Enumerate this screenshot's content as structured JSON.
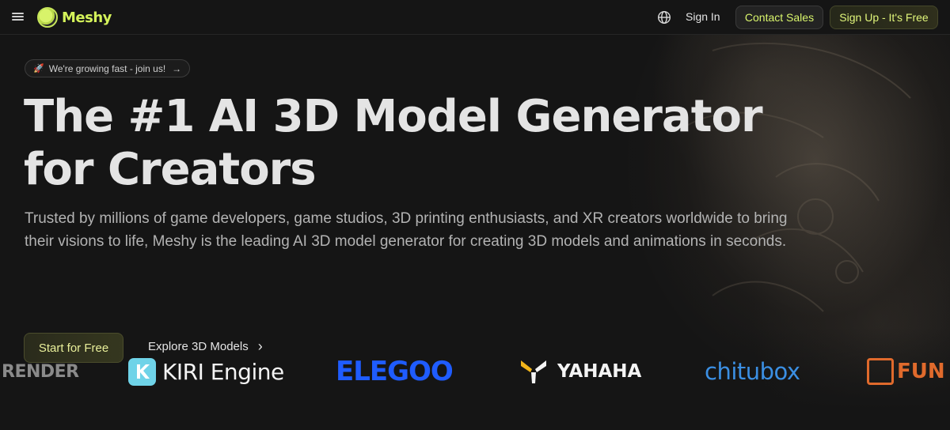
{
  "header": {
    "brand": "Meshy",
    "sign_in": "Sign In",
    "contact_sales": "Contact Sales",
    "sign_up": "Sign Up - It's Free"
  },
  "hero": {
    "announcement": "We're growing fast - join us!",
    "title_line1": "The #1 AI 3D Model Generator",
    "title_line2": "for Creators",
    "subtitle": "Trusted by millions of game developers, game studios, 3D printing enthusiasts, and XR creators worldwide to bring their visions to life, Meshy is the leading AI 3D model generator for creating 3D models and animations in seconds.",
    "start_button": "Start for Free",
    "explore_link": "Explore 3D Models"
  },
  "partners": {
    "render": "RENDER",
    "kiri": "KIRI Engine",
    "elegoo": "ELEGOO",
    "yahaha": "YAHAHA",
    "chitubox": "chitubox",
    "fun": "FUN"
  },
  "icons": {
    "menu": "menu-icon",
    "globe": "globe-icon",
    "rocket": "rocket-icon",
    "arrow": "arrow-right-icon",
    "chevron": "chevron-right-icon"
  },
  "colors": {
    "background": "#151515",
    "brand_accent": "#d4f25a",
    "elegoo_blue": "#1f5cff",
    "chitubox_blue": "#3b8fe3",
    "fun_orange": "#e06a2c",
    "kiri_teal": "#6fd3e8"
  }
}
